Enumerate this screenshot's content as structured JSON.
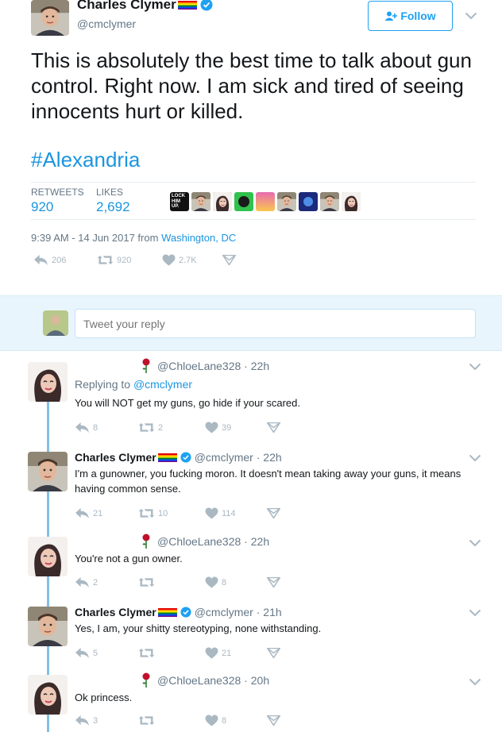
{
  "main": {
    "name": "Charles Clymer",
    "handle": "@cmclymer",
    "follow_label": "Follow",
    "text": "This is absolutely the best time to talk about gun control. Right now. I am sick and tired of seeing innocents hurt or killed.",
    "hashtag": "#Alexandria",
    "stats": {
      "retweets_label": "RETWEETS",
      "retweets": "920",
      "likes_label": "LIKES",
      "likes": "2,692"
    },
    "liker_badge": "LOCK HIM UP.",
    "timestamp": "9:39 AM - 14 Jun 2017 from",
    "location": "Washington, DC",
    "actions": {
      "replies": "206",
      "retweets": "920",
      "likes": "2.7K"
    }
  },
  "reply_box": {
    "placeholder": "Tweet your reply"
  },
  "replies": [
    {
      "name": "",
      "handle": "@ChloeLane328",
      "time": "22h",
      "replying_prefix": "Replying to",
      "replying_to": "@cmclymer",
      "text": "You will NOT get my guns, go hide if your scared.",
      "actions": {
        "replies": "8",
        "retweets": "2",
        "likes": "39"
      }
    },
    {
      "name": "Charles Clymer",
      "handle": "@cmclymer",
      "time": "22h",
      "text": "I'm a gunowner, you fucking moron. It doesn't mean taking away your guns, it means having common sense.",
      "actions": {
        "replies": "21",
        "retweets": "10",
        "likes": "114"
      }
    },
    {
      "name": "",
      "handle": "@ChloeLane328",
      "time": "22h",
      "text": "You're not a gun owner.",
      "actions": {
        "replies": "2",
        "retweets": "",
        "likes": "8"
      }
    },
    {
      "name": "Charles Clymer",
      "handle": "@cmclymer",
      "time": "21h",
      "text": "Yes, I am, your shitty stereotyping, none withstanding.",
      "actions": {
        "replies": "5",
        "retweets": "",
        "likes": "21"
      }
    },
    {
      "name": "",
      "handle": "@ChloeLane328",
      "time": "20h",
      "text": "Ok princess.",
      "actions": {
        "replies": "3",
        "retweets": "",
        "likes": "8"
      }
    }
  ],
  "colors": {
    "accent": "#1da1f2",
    "link": "#1b95e0",
    "muted": "#657786",
    "icon": "#aab8c2",
    "thread": "#80c1e6",
    "reply_bar": "#e8f5fd"
  }
}
